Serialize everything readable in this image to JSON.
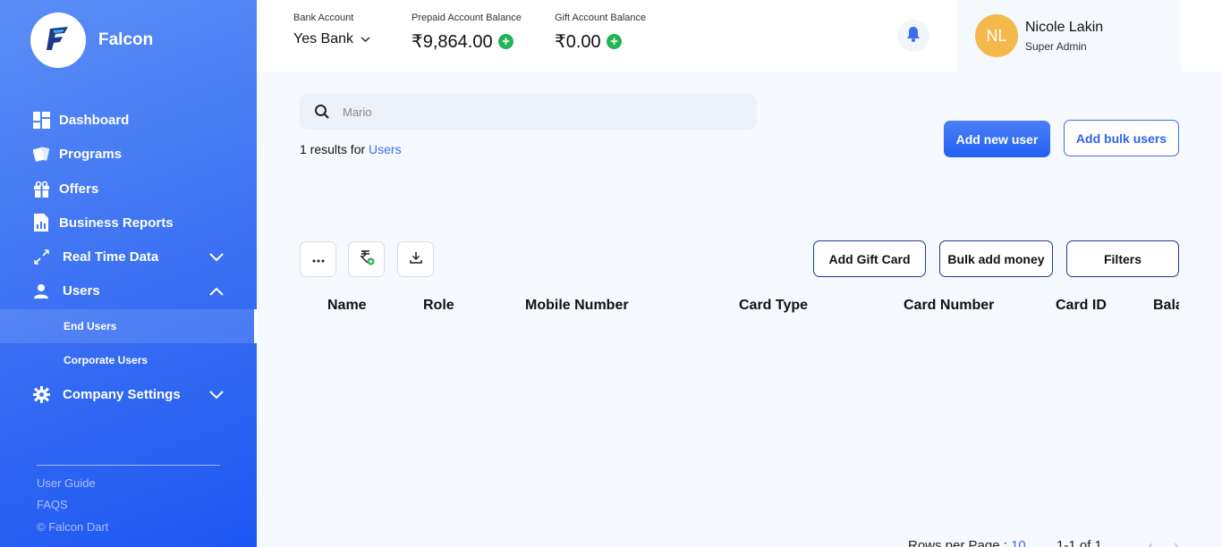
{
  "brand": {
    "name": "Falcon"
  },
  "sidebar": {
    "items": [
      {
        "label": "Dashboard",
        "icon": "dashboard-icon"
      },
      {
        "label": "Programs",
        "icon": "cards-icon"
      },
      {
        "label": "Offers",
        "icon": "gift-icon"
      },
      {
        "label": "Business Reports",
        "icon": "report-icon"
      },
      {
        "label": "Real Time Data",
        "icon": "transfer-icon",
        "expandable": true,
        "expanded": false
      },
      {
        "label": "Users",
        "icon": "users-icon",
        "expandable": true,
        "expanded": true
      },
      {
        "label": "Company Settings",
        "icon": "gear-icon",
        "expandable": true,
        "expanded": false
      }
    ],
    "users_sub": [
      {
        "label": "End Users",
        "active": true
      },
      {
        "label": "Corporate Users",
        "active": false
      }
    ],
    "footer": {
      "user_guide": "User Guide",
      "faqs": "FAQS",
      "copyright": "© Falcon Dart"
    }
  },
  "topbar": {
    "bank": {
      "label": "Bank Account",
      "value": "Yes Bank"
    },
    "prepaid": {
      "label": "Prepaid Account Balance",
      "value": "₹9,864.00"
    },
    "gift": {
      "label": "Gift Account Balance",
      "value": "₹0.00"
    },
    "user": {
      "initials": "NL",
      "name": "Nicole Lakin",
      "role": "Super Admin"
    }
  },
  "search": {
    "value": "Mario"
  },
  "results": {
    "prefix": "1 results for",
    "target": "Users"
  },
  "actions": {
    "add_new_user": "Add new user",
    "add_bulk_users": "Add bulk users",
    "add_gift_card": "Add Gift Card",
    "bulk_add_money": "Bulk add money",
    "filters": "Filters"
  },
  "table": {
    "columns": [
      "Name",
      "Role",
      "Mobile Number",
      "Card Type",
      "Card Number",
      "Card ID",
      "Balance"
    ]
  },
  "pagination": {
    "rows_label": "Rows per Page :",
    "rows_value": "10",
    "range": "1-1 of 1"
  },
  "colors": {
    "accent": "#3d6ef2",
    "success": "#23b456",
    "avatar": "#f5b84b"
  }
}
